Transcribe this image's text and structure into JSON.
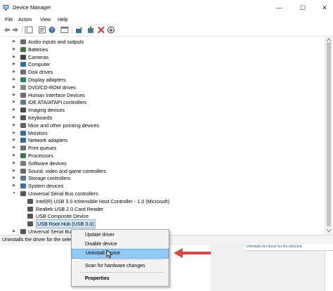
{
  "window": {
    "title": "Device Manager",
    "min_glyph": "—",
    "max_glyph": "☐",
    "close_glyph": "✕"
  },
  "menu": [
    "File",
    "Action",
    "View",
    "Help"
  ],
  "tree": [
    {
      "label": "Audio inputs and outputs",
      "expander": "▶",
      "icon": "speaker-icon",
      "color": "#6b6b6b"
    },
    {
      "label": "Batteries",
      "expander": "▶",
      "icon": "battery-icon",
      "color": "#3a7a3a"
    },
    {
      "label": "Cameras",
      "expander": "▶",
      "icon": "camera-icon",
      "color": "#444444"
    },
    {
      "label": "Computer",
      "expander": "▶",
      "icon": "computer-icon",
      "color": "#2f6fb0"
    },
    {
      "label": "Disk drives",
      "expander": "▶",
      "icon": "disk-drive-icon",
      "color": "#707070"
    },
    {
      "label": "Display adapters",
      "expander": "▶",
      "icon": "display-adapter-icon",
      "color": "#2a8a4a"
    },
    {
      "label": "DVD/CD-ROM drives",
      "expander": "▶",
      "icon": "dvd-drive-icon",
      "color": "#8a8a8a"
    },
    {
      "label": "Human Interface Devices",
      "expander": "▶",
      "icon": "hid-icon",
      "color": "#6a6a8a"
    },
    {
      "label": "IDE ATA/ATAPI controllers",
      "expander": "▶",
      "icon": "ide-controller-icon",
      "color": "#5a7a9a"
    },
    {
      "label": "Imaging devices",
      "expander": "▶",
      "icon": "imaging-device-icon",
      "color": "#4a4a4a"
    },
    {
      "label": "Keyboards",
      "expander": "▶",
      "icon": "keyboard-icon",
      "color": "#555555"
    },
    {
      "label": "Mice and other pointing devices",
      "expander": "▶",
      "icon": "mouse-icon",
      "color": "#606060"
    },
    {
      "label": "Monitors",
      "expander": "▶",
      "icon": "monitor-icon",
      "color": "#2f6fb0"
    },
    {
      "label": "Network adapters",
      "expander": "▶",
      "icon": "network-adapter-icon",
      "color": "#3a6a9a"
    },
    {
      "label": "Print queues",
      "expander": "▶",
      "icon": "printer-icon",
      "color": "#707070"
    },
    {
      "label": "Processors",
      "expander": "▶",
      "icon": "processor-icon",
      "color": "#3a7a3a"
    },
    {
      "label": "Software devices",
      "expander": "▶",
      "icon": "software-device-icon",
      "color": "#7a7a7a"
    },
    {
      "label": "Sound, video and game controllers",
      "expander": "▶",
      "icon": "sound-controller-icon",
      "color": "#6b6b6b"
    },
    {
      "label": "Storage controllers",
      "expander": "▶",
      "icon": "storage-controller-icon",
      "color": "#5a7a9a"
    },
    {
      "label": "System devices",
      "expander": "▶",
      "icon": "system-device-icon",
      "color": "#2f6fb0"
    },
    {
      "label": "Universal Serial Bus controllers",
      "expander": "▼",
      "icon": "usb-controller-icon",
      "color": "#555555"
    },
    {
      "label": "Intel(R) USB 3.0 eXtensible Host Controller - 1.0 (Microsoft)",
      "expander": "",
      "icon": "usb-device-icon",
      "color": "#555555"
    },
    {
      "label": "Realtek USB 2.0 Card Reader",
      "expander": "",
      "icon": "usb-device-icon",
      "color": "#555555"
    },
    {
      "label": "USB Composite Device",
      "expander": "",
      "icon": "usb-device-icon",
      "color": "#555555"
    },
    {
      "label": "USB Root Hub (USB 3.0)",
      "expander": "",
      "icon": "usb-device-icon",
      "color": "#555555",
      "selected": true
    },
    {
      "label": "Universal Serial Bus",
      "expander": "▶",
      "icon": "usb-controller-icon",
      "color": "#555555"
    }
  ],
  "status": {
    "text": "Uninstalls the driver for the sele"
  },
  "context_menu": {
    "items": [
      {
        "label": "Update driver"
      },
      {
        "label": "Disable device"
      },
      {
        "label": "Uninstall device",
        "highlighted": true
      },
      {
        "label": "Scan for hardware changes"
      },
      {
        "label": "Properties",
        "bold": true
      }
    ]
  },
  "annotation": {
    "arrow_color": "#e0443a"
  },
  "background_window": {
    "text": "Uninstalls the driver for the selected"
  }
}
